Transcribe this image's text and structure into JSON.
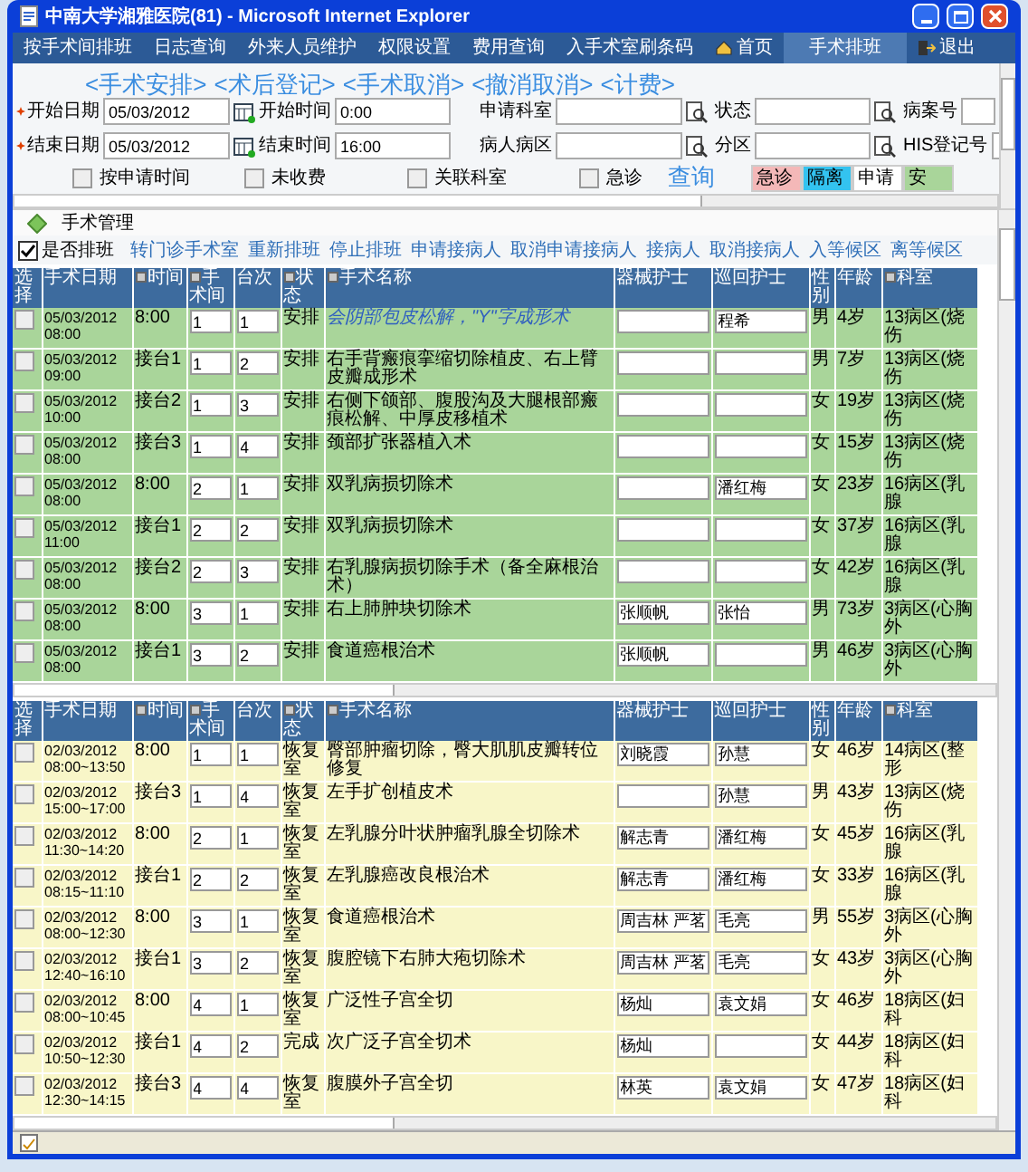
{
  "window": {
    "title": "中南大学湘雅医院(81) - Microsoft Internet Explorer"
  },
  "nav": [
    {
      "label": "按手术间排班",
      "kind": "text",
      "selected": false
    },
    {
      "label": "日志查询",
      "kind": "text",
      "selected": false
    },
    {
      "label": "外来人员维护",
      "kind": "text",
      "selected": false
    },
    {
      "label": "权限设置",
      "kind": "text",
      "selected": false
    },
    {
      "label": "费用查询",
      "kind": "text",
      "selected": false
    },
    {
      "label": "入手术室刷条码",
      "kind": "text",
      "selected": false
    },
    {
      "label": "首页",
      "kind": "home",
      "selected": false
    },
    {
      "label": "手术排班",
      "kind": "text",
      "selected": true
    },
    {
      "label": "退出",
      "kind": "exit",
      "selected": false
    }
  ],
  "actions": [
    "<手术安排>",
    "<术后登记>",
    "<手术取消>",
    "<撤消取消>",
    "<计费>"
  ],
  "filters": [
    [
      {
        "label": "开始日期",
        "required": true,
        "value": "05/03/2012",
        "kind": "date"
      },
      {
        "label": "开始时间",
        "required": false,
        "value": "0:00",
        "kind": "text"
      },
      {
        "label": "申请科室",
        "required": false,
        "kind": "lookup"
      },
      {
        "label": "状态",
        "required": false,
        "kind": "lookup"
      },
      {
        "label": "病案号",
        "required": false,
        "kind": "text"
      }
    ],
    [
      {
        "label": "结束日期",
        "required": true,
        "value": "05/03/2012",
        "kind": "date"
      },
      {
        "label": "结束时间",
        "required": false,
        "value": "16:00",
        "kind": "text"
      },
      {
        "label": "病人病区",
        "required": false,
        "kind": "lookup"
      },
      {
        "label": "分区",
        "required": false,
        "kind": "lookup"
      },
      {
        "label": "HIS登记号",
        "required": false,
        "kind": "text"
      }
    ]
  ],
  "options": [
    {
      "label": "按申请时间",
      "checked": false
    },
    {
      "label": "未收费",
      "checked": false
    },
    {
      "label": "关联科室",
      "checked": false
    },
    {
      "label": "急诊",
      "checked": false
    }
  ],
  "query_button": "查询",
  "legend": [
    {
      "label": "急诊",
      "color": "#f4b8b8"
    },
    {
      "label": "隔离",
      "color": "#33c3f0"
    },
    {
      "label": "申请",
      "color": "#ffffff"
    },
    {
      "label": "安",
      "color": "#a9d59a"
    }
  ],
  "section": {
    "title": "手术管理"
  },
  "toolbar": {
    "schedule": {
      "label": "是否排班",
      "checked": true
    },
    "links": [
      "转门诊手术室",
      "重新排班",
      "停止排班",
      "申请接病人",
      "取消申请接病人",
      "接病人",
      "取消接病人",
      "入等候区",
      "离等候区"
    ]
  },
  "scheduled_columns": [
    {
      "label": "选择",
      "sortable": false
    },
    {
      "label": "手术日期",
      "sortable": false
    },
    {
      "label": "时间",
      "sortable": true
    },
    {
      "label": "手术间",
      "sortable": true
    },
    {
      "label": "台次",
      "sortable": false
    },
    {
      "label": "状态",
      "sortable": true
    },
    {
      "label": "手术名称",
      "sortable": true
    },
    {
      "label": "器械护士",
      "sortable": false
    },
    {
      "label": "巡回护士",
      "sortable": false
    },
    {
      "label": "性别",
      "sortable": false
    },
    {
      "label": "年龄",
      "sortable": false
    },
    {
      "label": "科室",
      "sortable": true
    }
  ],
  "scheduled": [
    {
      "checked": false,
      "date": "05/03/2012 08:00",
      "time": "8:00",
      "room": "1",
      "seq": "1",
      "status": "安排",
      "name": "会阴部包皮松解，\"Y\"字成形术",
      "emphasized": true,
      "circ_nurse": "程希",
      "sex": "男",
      "age": "4岁",
      "dept": "13病区(烧伤"
    },
    {
      "checked": false,
      "date": "05/03/2012 09:00",
      "time": "接台1",
      "room": "1",
      "seq": "2",
      "status": "安排",
      "name": "右手背瘢痕挛缩切除植皮、右上臂皮瓣成形术",
      "emphasized": false,
      "sex": "男",
      "age": "7岁",
      "dept": "13病区(烧伤"
    },
    {
      "checked": false,
      "date": "05/03/2012 10:00",
      "time": "接台2",
      "room": "1",
      "seq": "3",
      "status": "安排",
      "name": "右侧下颌部、腹股沟及大腿根部瘢痕松解、中厚皮移植术",
      "emphasized": false,
      "sex": "女",
      "age": "19岁",
      "dept": "13病区(烧伤"
    },
    {
      "checked": false,
      "date": "05/03/2012 08:00",
      "time": "接台3",
      "room": "1",
      "seq": "4",
      "status": "安排",
      "name": "颈部扩张器植入术",
      "emphasized": false,
      "sex": "女",
      "age": "15岁",
      "dept": "13病区(烧伤"
    },
    {
      "checked": false,
      "date": "05/03/2012 08:00",
      "time": "8:00",
      "room": "2",
      "seq": "1",
      "status": "安排",
      "name": "双乳病损切除术",
      "emphasized": false,
      "circ_nurse": "潘红梅",
      "sex": "女",
      "age": "23岁",
      "dept": "16病区(乳腺"
    },
    {
      "checked": false,
      "date": "05/03/2012 11:00",
      "time": "接台1",
      "room": "2",
      "seq": "2",
      "status": "安排",
      "name": "双乳病损切除术",
      "emphasized": false,
      "sex": "女",
      "age": "37岁",
      "dept": "16病区(乳腺"
    },
    {
      "checked": false,
      "date": "05/03/2012 08:00",
      "time": "接台2",
      "room": "2",
      "seq": "3",
      "status": "安排",
      "name": "右乳腺病损切除手术（备全麻根治术）",
      "emphasized": false,
      "sex": "女",
      "age": "42岁",
      "dept": "16病区(乳腺"
    },
    {
      "checked": false,
      "date": "05/03/2012 08:00",
      "time": "8:00",
      "room": "3",
      "seq": "1",
      "status": "安排",
      "name": "右上肺肿块切除术",
      "emphasized": false,
      "scrub_nurse": "张顺帆",
      "circ_nurse": "张怡",
      "sex": "男",
      "age": "73岁",
      "dept": "3病区(心胸外"
    },
    {
      "checked": false,
      "date": "05/03/2012 08:00",
      "time": "接台1",
      "room": "3",
      "seq": "2",
      "status": "安排",
      "name": "食道癌根治术",
      "emphasized": false,
      "scrub_nurse": "张顺帆",
      "sex": "男",
      "age": "46岁",
      "dept": "3病区(心胸外"
    }
  ],
  "finished_columns": [
    {
      "label": "选择",
      "sortable": false
    },
    {
      "label": "手术日期",
      "sortable": false
    },
    {
      "label": "时间",
      "sortable": true
    },
    {
      "label": "手术间",
      "sortable": true
    },
    {
      "label": "台次",
      "sortable": false
    },
    {
      "label": "状态",
      "sortable": true
    },
    {
      "label": "手术名称",
      "sortable": true
    },
    {
      "label": "器械护士",
      "sortable": false
    },
    {
      "label": "巡回护士",
      "sortable": false
    },
    {
      "label": "性别",
      "sortable": false
    },
    {
      "label": "年龄",
      "sortable": false
    },
    {
      "label": "科室",
      "sortable": true
    }
  ],
  "finished": [
    {
      "checked": false,
      "date": "02/03/2012",
      "period": "08:00~13:50",
      "time": "8:00",
      "room": "1",
      "seq": "1",
      "status": "恢复室",
      "name": "臀部肿瘤切除，臀大肌肌皮瓣转位修复",
      "scrub_nurse": "刘晓霞",
      "circ_nurse": "孙慧",
      "sex": "女",
      "age": "46岁",
      "dept": "14病区(整形"
    },
    {
      "checked": false,
      "date": "02/03/2012",
      "period": "15:00~17:00",
      "time": "接台3",
      "room": "1",
      "seq": "4",
      "status": "恢复室",
      "name": "左手扩创植皮术",
      "circ_nurse": "孙慧",
      "sex": "男",
      "age": "43岁",
      "dept": "13病区(烧伤"
    },
    {
      "checked": false,
      "date": "02/03/2012",
      "period": "11:30~14:20",
      "time": "8:00",
      "room": "2",
      "seq": "1",
      "status": "恢复室",
      "name": "左乳腺分叶状肿瘤乳腺全切除术",
      "scrub_nurse": "解志青",
      "circ_nurse": "潘红梅",
      "sex": "女",
      "age": "45岁",
      "dept": "16病区(乳腺"
    },
    {
      "checked": false,
      "date": "02/03/2012",
      "period": "08:15~11:10",
      "time": "接台1",
      "room": "2",
      "seq": "2",
      "status": "恢复室",
      "name": "左乳腺癌改良根治术",
      "scrub_nurse": "解志青",
      "circ_nurse": "潘红梅",
      "sex": "女",
      "age": "33岁",
      "dept": "16病区(乳腺"
    },
    {
      "checked": false,
      "date": "02/03/2012",
      "period": "08:00~12:30",
      "time": "8:00",
      "room": "3",
      "seq": "1",
      "status": "恢复室",
      "name": "食道癌根治术",
      "scrub_nurse": "周吉林 严茗",
      "circ_nurse": "毛亮",
      "sex": "男",
      "age": "55岁",
      "dept": "3病区(心胸外"
    },
    {
      "checked": false,
      "date": "02/03/2012",
      "period": "12:40~16:10",
      "time": "接台1",
      "room": "3",
      "seq": "2",
      "status": "恢复室",
      "name": "腹腔镜下右肺大疱切除术",
      "scrub_nurse": "周吉林 严茗",
      "circ_nurse": "毛亮",
      "sex": "女",
      "age": "43岁",
      "dept": "3病区(心胸外"
    },
    {
      "checked": false,
      "date": "02/03/2012",
      "period": "08:00~10:45",
      "time": "8:00",
      "room": "4",
      "seq": "1",
      "status": "恢复室",
      "name": "广泛性子宫全切",
      "scrub_nurse": "杨灿",
      "circ_nurse": "袁文娟",
      "sex": "女",
      "age": "46岁",
      "dept": "18病区(妇科"
    },
    {
      "checked": false,
      "date": "02/03/2012",
      "period": "10:50~12:30",
      "time": "接台1",
      "room": "4",
      "seq": "2",
      "status": "完成",
      "name": "次广泛子宫全切术",
      "scrub_nurse": "杨灿",
      "sex": "女",
      "age": "44岁",
      "dept": "18病区(妇科"
    },
    {
      "checked": false,
      "date": "02/03/2012",
      "period": "12:30~14:15",
      "time": "接台3",
      "room": "4",
      "seq": "4",
      "status": "恢复室",
      "name": "腹膜外子宫全切",
      "scrub_nurse": "林英",
      "circ_nurse": "袁文娟",
      "sex": "女",
      "age": "47岁",
      "dept": "18病区(妇科"
    }
  ]
}
